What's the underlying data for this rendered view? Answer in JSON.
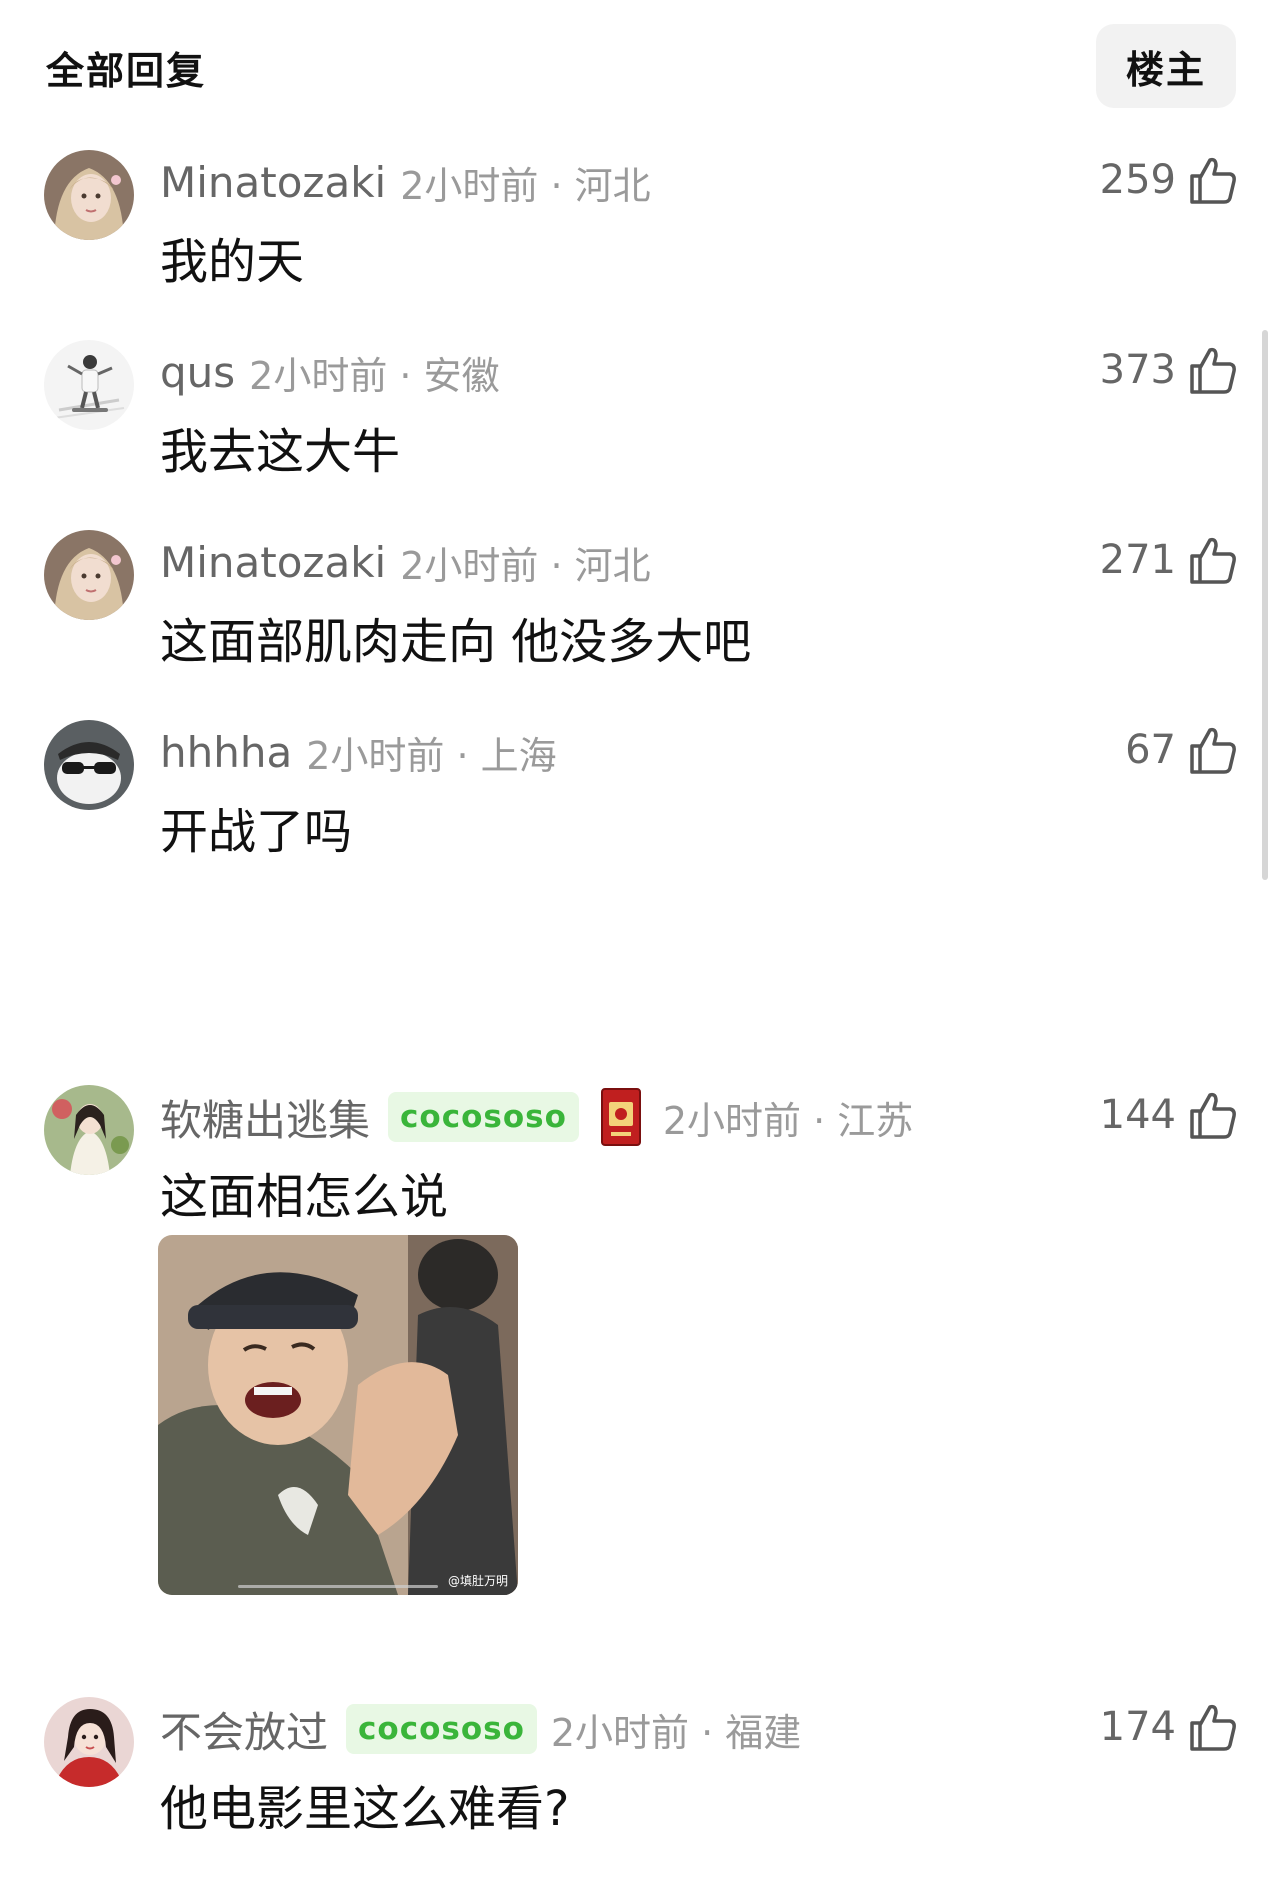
{
  "header": {
    "title": "全部回复",
    "owner_button": "楼主"
  },
  "comments": [
    {
      "username": "Minatozaki",
      "time_location": "2小时前 · 河北",
      "text": "我的天",
      "likes": "259",
      "avatar_icon": "avatar-girl-blonde"
    },
    {
      "username": "qus",
      "time_location": "2小时前 · 安徽",
      "text": "我去这大牛",
      "likes": "373",
      "avatar_icon": "avatar-skater"
    },
    {
      "username": "Minatozaki",
      "time_location": "2小时前 · 河北",
      "text": "这面部肌肉走向 他没多大吧",
      "likes": "271",
      "avatar_icon": "avatar-girl-blonde"
    },
    {
      "username": "hhhha",
      "time_location": "2小时前 · 上海",
      "text": "开战了吗",
      "likes": "67",
      "avatar_icon": "avatar-sunglasses"
    },
    {
      "username": "软糖出逃集",
      "badge": "cocososo",
      "time_location": "2小时前 · 江苏",
      "text": "这面相怎么说",
      "likes": "144",
      "avatar_icon": "avatar-girl-garden",
      "has_card_icon": true,
      "photo": {
        "watermark": "@填肚万明"
      }
    },
    {
      "username": "不会放过",
      "badge": "cocososo",
      "time_location": "2小时前 · 福建",
      "text": "他电影里这么难看?",
      "likes": "174",
      "avatar_icon": "avatar-girl-red"
    }
  ],
  "colors": {
    "badge_bg": "#e8f8e4",
    "badge_text": "#3ab53a",
    "meta_gray": "#9a9a9a",
    "username_gray": "#666666"
  }
}
